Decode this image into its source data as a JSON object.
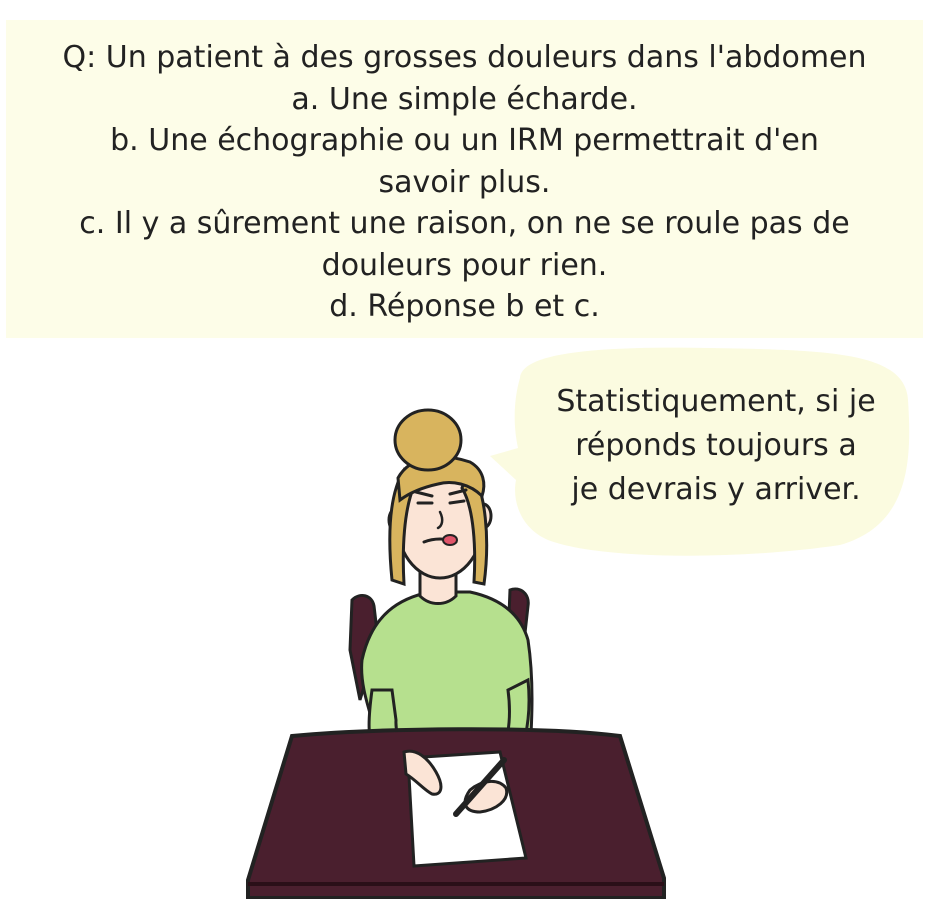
{
  "caption": {
    "lines": [
      "Q: Un patient à des grosses douleurs dans l'abdomen",
      "a. Une simple écharde.",
      "b. Une échographie ou un IRM permettrait d'en",
      "savoir plus.",
      "c. Il y a sûrement une raison, on ne se roule pas de",
      "douleurs pour rien.",
      "d. Réponse b et c."
    ]
  },
  "speech_bubble": {
    "lines": [
      "Statistiquement, si je",
      "réponds toujours a",
      "je devrais y arriver."
    ]
  },
  "colors": {
    "caption_bg": "#fdfde8",
    "bubble_bg": "#fbfbe0",
    "sweater": "#b6e08e",
    "hair": "#d8b45e",
    "desk": "#4a1f2e",
    "skin": "#fbe4d6",
    "outline": "#222222"
  }
}
